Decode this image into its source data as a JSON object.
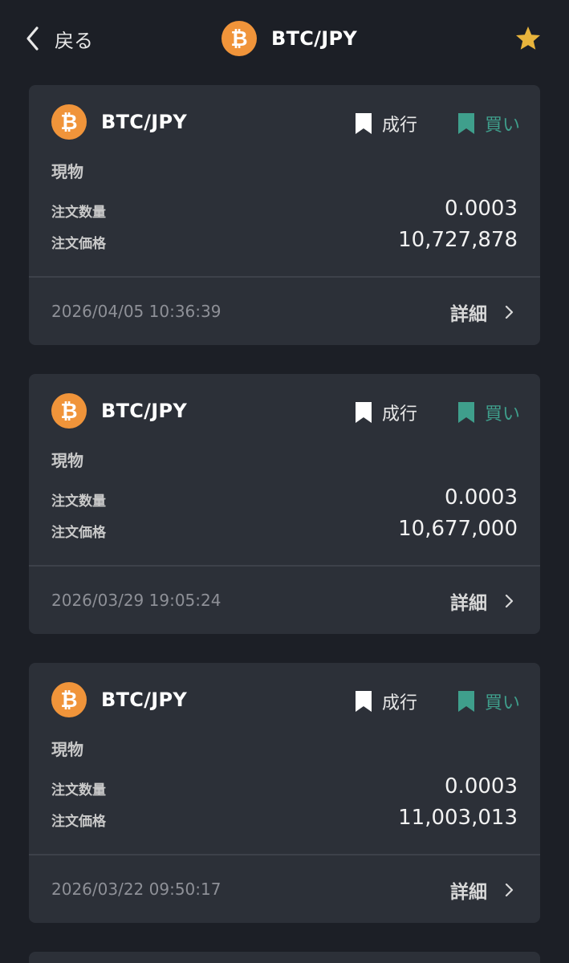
{
  "header": {
    "back_label": "戻る",
    "title": "BTC/JPY",
    "coin_symbol": "₿"
  },
  "colors": {
    "background": "#1c1f26",
    "card": "#2c3038",
    "btc_orange": "#f0943a",
    "buy_green": "#3f9f8c",
    "star_gold": "#e8b43c"
  },
  "orders": [
    {
      "pair": "BTC/JPY",
      "order_type": "成行",
      "side": "買い",
      "market": "現物",
      "qty_label": "注文数量",
      "qty": "0.0003",
      "price_label": "注文価格",
      "price": "10,727,878",
      "timestamp": "2026/04/05 10:36:39",
      "detail_label": "詳細"
    },
    {
      "pair": "BTC/JPY",
      "order_type": "成行",
      "side": "買い",
      "market": "現物",
      "qty_label": "注文数量",
      "qty": "0.0003",
      "price_label": "注文価格",
      "price": "10,677,000",
      "timestamp": "2026/03/29 19:05:24",
      "detail_label": "詳細"
    },
    {
      "pair": "BTC/JPY",
      "order_type": "成行",
      "side": "買い",
      "market": "現物",
      "qty_label": "注文数量",
      "qty": "0.0003",
      "price_label": "注文価格",
      "price": "11,003,013",
      "timestamp": "2026/03/22 09:50:17",
      "detail_label": "詳細"
    }
  ]
}
